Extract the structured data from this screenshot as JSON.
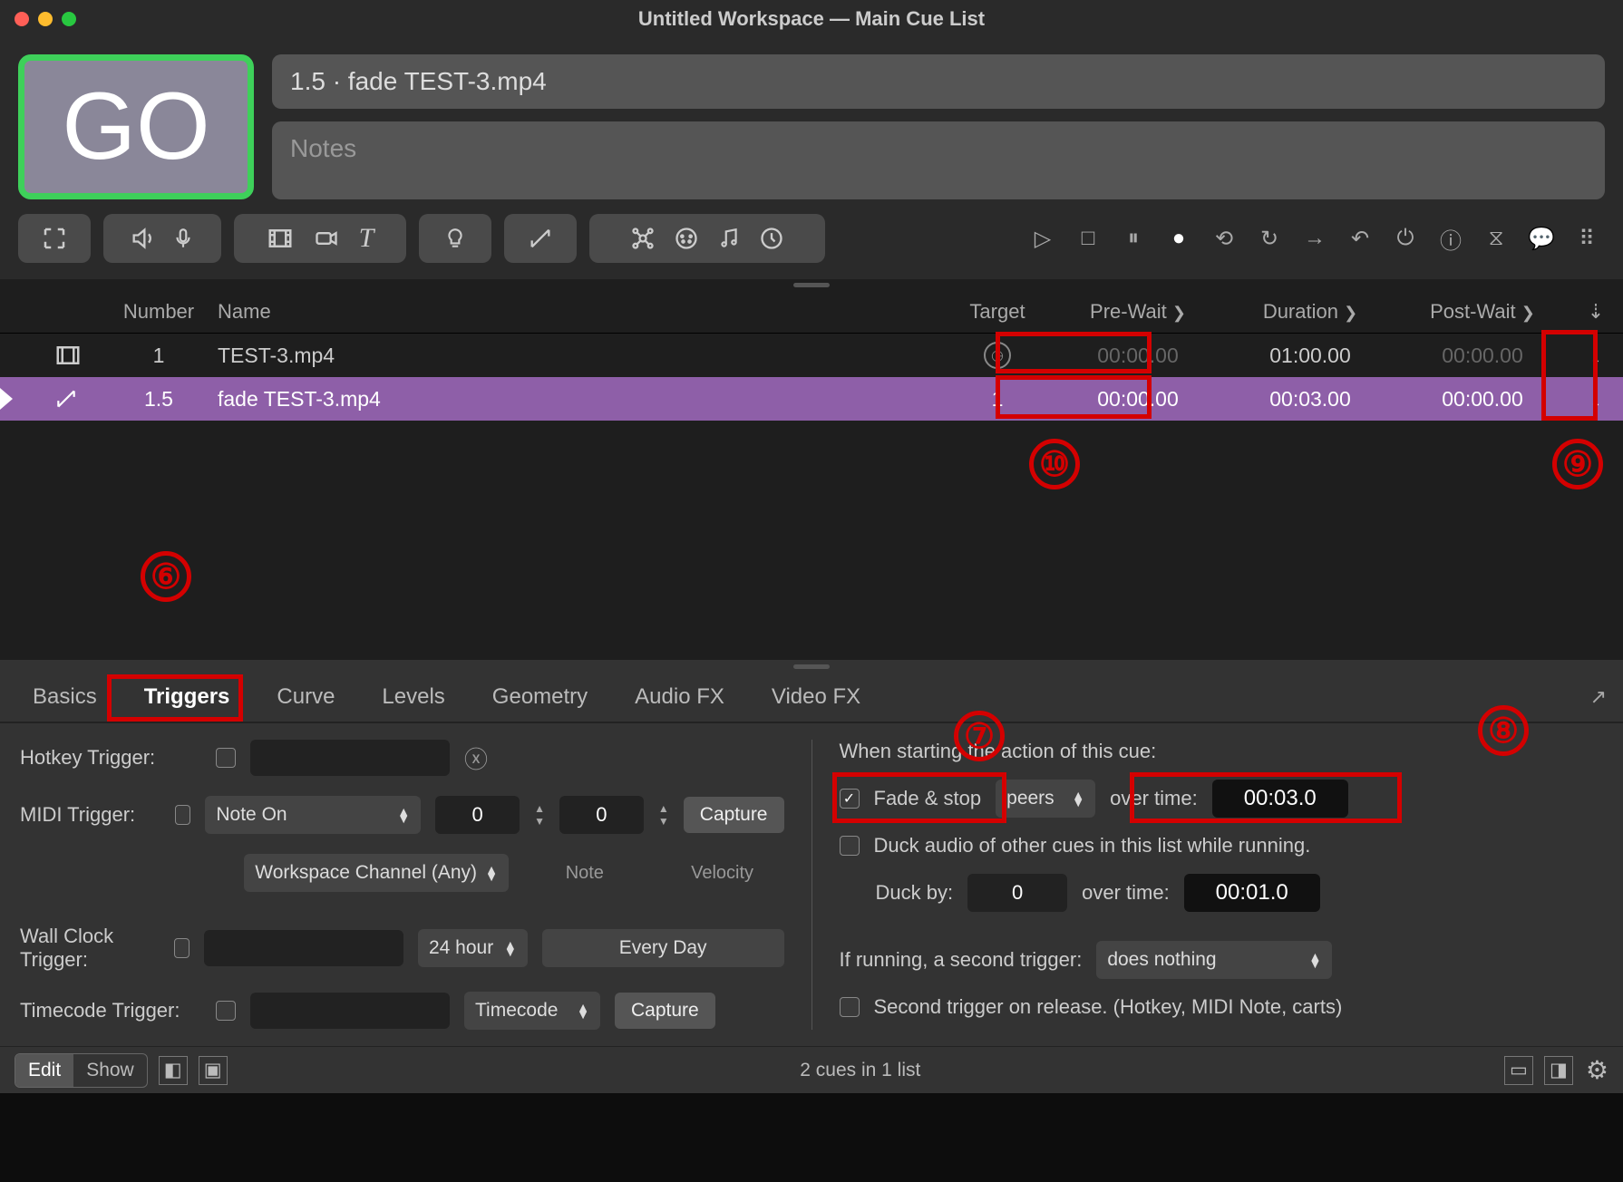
{
  "window": {
    "title": "Untitled Workspace — Main Cue List"
  },
  "go_button": {
    "label": "GO"
  },
  "cue_title": "1.5 · fade TEST-3.mp4",
  "notes_placeholder": "Notes",
  "columns": {
    "number": "Number",
    "name": "Name",
    "target": "Target",
    "prewait": "Pre-Wait",
    "duration": "Duration",
    "postwait": "Post-Wait"
  },
  "cues": [
    {
      "number": "1",
      "name": "TEST-3.mp4",
      "target": "",
      "prewait": "00:00.00",
      "duration": "01:00.00",
      "postwait": "00:00.00",
      "cont": "↓"
    },
    {
      "number": "1.5",
      "name": "fade TEST-3.mp4",
      "target": "1",
      "prewait": "00:00.00",
      "duration": "00:03.00",
      "postwait": "00:00.00",
      "cont": "↓"
    }
  ],
  "tabs": [
    "Basics",
    "Triggers",
    "Curve",
    "Levels",
    "Geometry",
    "Audio FX",
    "Video FX"
  ],
  "active_tab": "Triggers",
  "triggers": {
    "hotkey_label": "Hotkey Trigger:",
    "midi_label": "MIDI Trigger:",
    "midi_type": "Note On",
    "midi_channel": "Workspace Channel (Any)",
    "midi_v1": "0",
    "midi_v2": "0",
    "midi_sub1": "Note",
    "midi_sub2": "Velocity",
    "capture": "Capture",
    "wallclock_label": "Wall Clock Trigger:",
    "wallclock_fmt": "24 hour",
    "wallclock_days": "Every Day",
    "timecode_label": "Timecode Trigger:",
    "timecode_mode": "Timecode",
    "when_starting": "When starting the action of this cue:",
    "fade_stop": "Fade & stop",
    "fade_scope": "peers",
    "over_time_label": "over time:",
    "fade_time": "00:03.0",
    "duck_label": "Duck audio of other cues in this list while running.",
    "duck_by_label": "Duck by:",
    "duck_by": "0",
    "duck_time": "00:01.0",
    "second_trigger_label": "If running, a second trigger:",
    "second_trigger_mode": "does nothing",
    "second_on_release": "Second trigger on release. (Hotkey, MIDI Note, carts)"
  },
  "status": {
    "edit": "Edit",
    "show": "Show",
    "summary": "2 cues in 1 list"
  },
  "annotations": {
    "a6": "⑥",
    "a7": "⑦",
    "a8": "⑧",
    "a9": "⑨",
    "a10": "⑩"
  }
}
